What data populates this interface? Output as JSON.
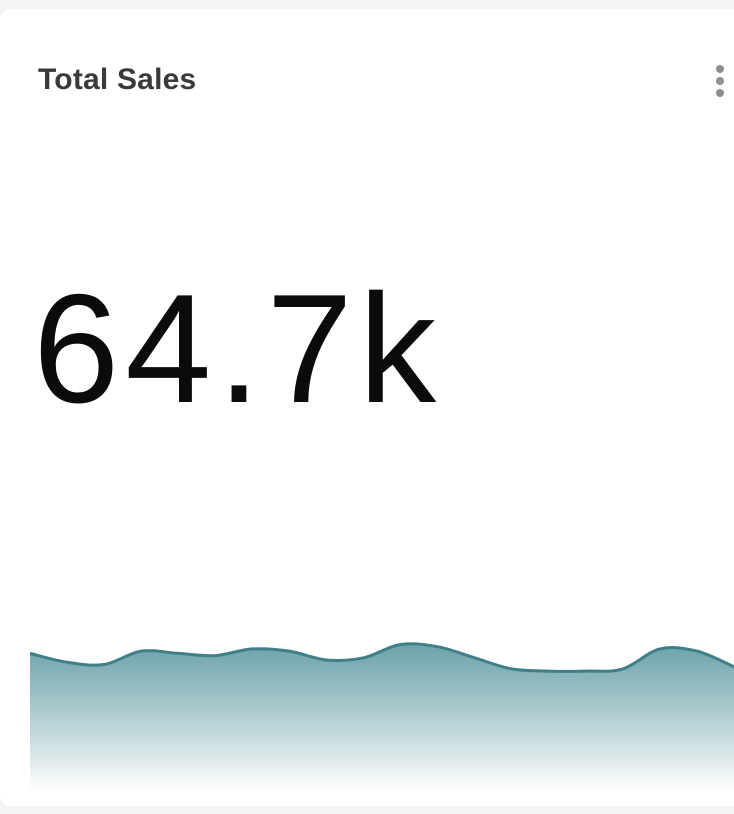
{
  "card": {
    "title": "Total Sales",
    "value": "64.7k",
    "menu_icon": "more-vertical-icon"
  },
  "colors": {
    "card_background": "#ffffff",
    "page_background": "#f4f4f4",
    "line": "#3f7f8a",
    "area_top": "#5f9aa2",
    "title_text": "#3a3a3a",
    "value_text": "#0b0b0b",
    "menu_dots": "#8a8f94"
  },
  "chart_data": {
    "type": "area",
    "x": [
      0,
      1,
      2,
      3,
      4,
      5,
      6,
      7,
      8,
      9,
      10,
      11,
      12,
      13,
      14,
      15,
      16,
      17,
      18,
      19
    ],
    "values": [
      62,
      58,
      57,
      63,
      62,
      61,
      64,
      63,
      59,
      60,
      66,
      65,
      60,
      55,
      54,
      54,
      55,
      64,
      63,
      56
    ],
    "ylim": [
      0,
      100
    ],
    "axes_visible": false,
    "grid": false,
    "legend": "none"
  }
}
